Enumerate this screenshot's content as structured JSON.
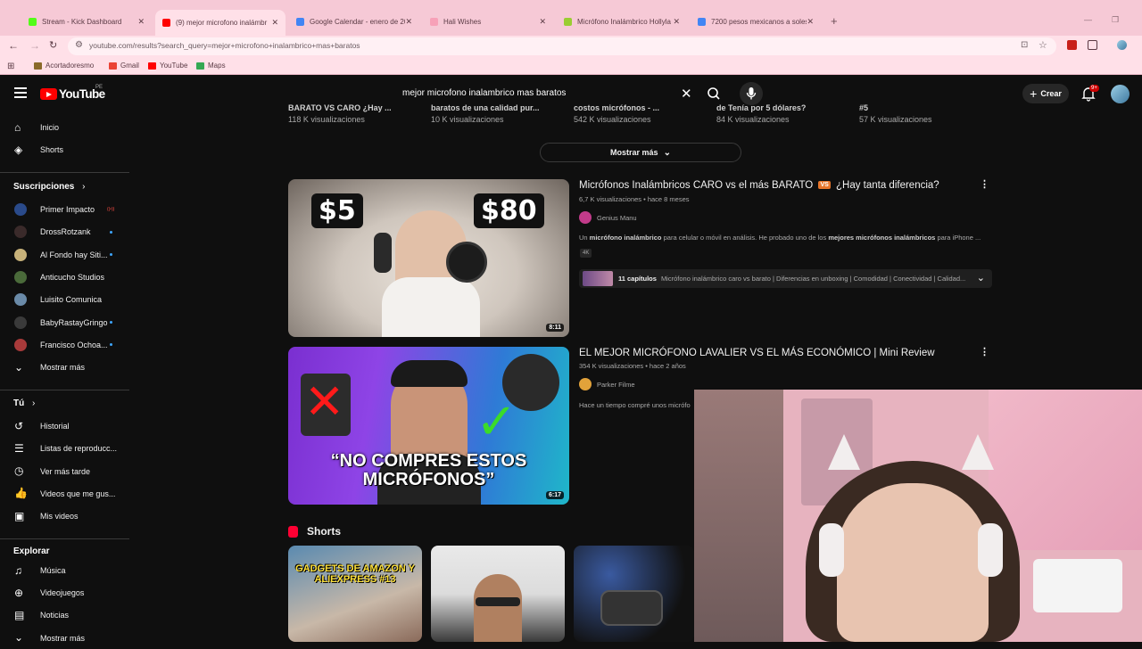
{
  "browser": {
    "tabs": [
      {
        "title": "Stream - Kick Dashboard",
        "color": "#53fc18",
        "active": false
      },
      {
        "title": "(9) mejor microfono inalámbr",
        "color": "#ff0000",
        "active": true
      },
      {
        "title": "Google Calendar - enero de 20",
        "color": "#4285f4",
        "active": false
      },
      {
        "title": "Hali Wishes",
        "color": "#f7a1b8",
        "active": false
      },
      {
        "title": "Micrófono Inalámbrico Hollyla",
        "color": "#9acd32",
        "active": false
      },
      {
        "title": "7200 pesos mexicanos a soles",
        "color": "#4285f4",
        "active": false
      }
    ],
    "new_tab": "+",
    "url": "youtube.com/results?search_query=mejor+microfono+inalambrico+mas+baratos",
    "bookmarks": [
      {
        "label": "Acortadoresmo",
        "color": "#8a6a2a"
      },
      {
        "label": "Gmail",
        "color": "#ea4335"
      },
      {
        "label": "YouTube",
        "color": "#ff0000"
      },
      {
        "label": "Maps",
        "color": "#34a853"
      }
    ]
  },
  "header": {
    "logo_text": "YouTube",
    "country_code": "PE",
    "search_query": "mejor microfono inalambrico mas baratos",
    "create_label": "Crear",
    "notification_count": "9+"
  },
  "sidebar": {
    "top_items": [
      {
        "label": "Inicio",
        "icon": "home-icon"
      },
      {
        "label": "Shorts",
        "icon": "shorts-icon"
      }
    ],
    "subscriptions_title": "Suscripciones",
    "subscriptions": [
      {
        "label": "Primer Impacto",
        "color": "#2a4a8a",
        "badge": "live"
      },
      {
        "label": "DrossRotzank",
        "color": "#3a2a2a",
        "badge": "dot"
      },
      {
        "label": "Al Fondo hay Siti...",
        "color": "#c8b27a",
        "badge": "dot"
      },
      {
        "label": "Anticucho Studios",
        "color": "#4a6a3a",
        "badge": ""
      },
      {
        "label": "Luisito Comunica",
        "color": "#6a8aa8",
        "badge": ""
      },
      {
        "label": "BabyRastayGringo",
        "color": "#3a3a3a",
        "badge": "dot"
      },
      {
        "label": "Francisco Ochoa...",
        "color": "#a83a3a",
        "badge": "dot"
      }
    ],
    "subscriptions_more": "Mostrar más",
    "you_title": "Tú",
    "you_items": [
      {
        "label": "Historial",
        "icon": "history-icon"
      },
      {
        "label": "Listas de reproducc...",
        "icon": "playlist-icon"
      },
      {
        "label": "Ver más tarde",
        "icon": "clock-icon"
      },
      {
        "label": "Videos que me gus...",
        "icon": "thumbs-up-icon"
      },
      {
        "label": "Mis videos",
        "icon": "my-videos-icon"
      }
    ],
    "explore_title": "Explorar",
    "explore_items": [
      {
        "label": "Música",
        "icon": "music-icon"
      },
      {
        "label": "Videojuegos",
        "icon": "gamepad-icon"
      },
      {
        "label": "Noticias",
        "icon": "news-icon"
      },
      {
        "label": "Mostrar más",
        "icon": "chevron-down-icon"
      }
    ]
  },
  "previous_row": [
    {
      "title": "BARATO VS CARO ¿Hay ...",
      "views": "118 K visualizaciones"
    },
    {
      "title": "baratos de una calidad pur...",
      "views": "10 K visualizaciones"
    },
    {
      "title": "costos micrófonos - ...",
      "views": "542 K visualizaciones"
    },
    {
      "title": "de Tenía por 5 dólares?",
      "views": "84 K visualizaciones"
    },
    {
      "title": "#5",
      "views": "57 K visualizaciones"
    }
  ],
  "show_more_label": "Mostrar más",
  "videos": [
    {
      "title": "Micrófonos Inalámbricos CARO vs el más BARATO",
      "vs": "VS",
      "title_tail": "¿Hay tanta diferencia?",
      "meta": "6,7 K visualizaciones • hace 8 meses",
      "channel": "Genius Manu",
      "description": "Un micrófono inalámbrico para celular o móvil en análisis. He probado uno de los mejores micrófonos inalámbricos para iPhone ...",
      "tag": "4K",
      "chapters_count": "11 capítulos",
      "chapters_text": "Micrófono inalámbrico caro vs barato | Diferencias en unboxing | Comodidad | Conectividad | Calidad...",
      "duration": "8:11",
      "thumb_price_left": "$5",
      "thumb_price_right": "$80"
    },
    {
      "title": "EL MEJOR MICRÓFONO LAVALIER VS EL MÁS ECONÓMICO | Mini Review",
      "meta": "354 K visualizaciones • hace 2 años",
      "channel": "Parker Filme",
      "description": "Hace un tiempo compré unos micrófo",
      "duration": "6:17",
      "thumb_text": "“NO COMPRES ESTOS MICRÓFONOS”"
    }
  ],
  "shorts": {
    "title": "Shorts",
    "items": [
      {
        "caption": "GADGETS DE AMAZON Y ALIEXPRESS #13"
      },
      {
        "caption": ""
      },
      {
        "caption": ""
      }
    ]
  }
}
